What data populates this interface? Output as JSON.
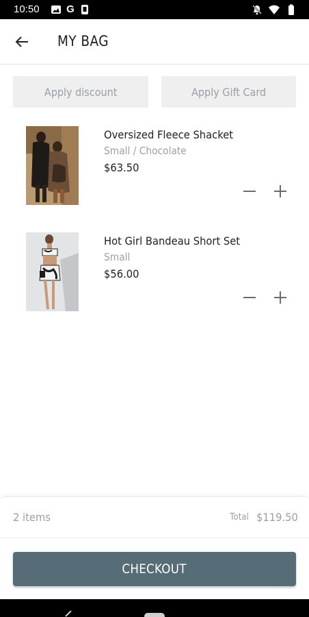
{
  "status_bar": {
    "time": "10:50",
    "left_icons": [
      "photo-icon",
      "google-g-icon",
      "screenshot-icon"
    ],
    "right_icons": [
      "notifications-off-icon",
      "wifi-icon",
      "battery-icon"
    ],
    "google_letter": "G"
  },
  "header": {
    "title": "MY BAG",
    "back_icon": "arrow-left-icon"
  },
  "actions": {
    "apply_discount": "Apply discount",
    "apply_gift_card": "Apply Gift Card"
  },
  "cart": {
    "items": [
      {
        "name": "Oversized Fleece Shacket",
        "variant": "Small / Chocolate",
        "price": "$63.50"
      },
      {
        "name": "Hot Girl Bandeau Short Set",
        "variant": "Small",
        "price": "$56.00"
      }
    ]
  },
  "summary": {
    "item_count": "2 items",
    "total_label": "Total",
    "total_value": "$119.50"
  },
  "checkout": {
    "label": "CHECKOUT",
    "color": "#566c76"
  },
  "colors": {
    "muted_text": "#9aa0a6",
    "ghost_button": "#efefef"
  }
}
